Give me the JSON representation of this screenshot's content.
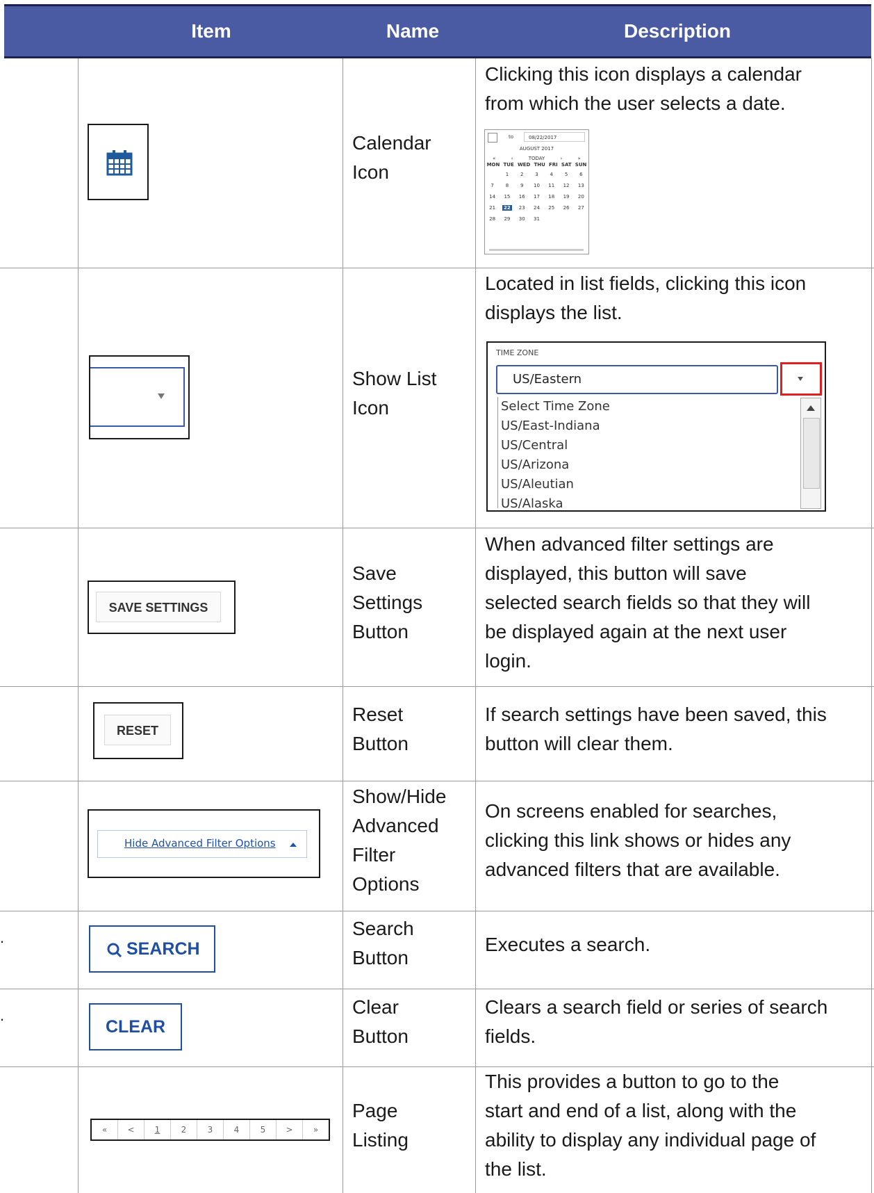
{
  "header": {
    "item": "Item",
    "name": "Name",
    "description": "Description"
  },
  "rows": [
    {
      "name_lines": [
        "Calendar",
        "Icon"
      ],
      "desc_lines": [
        "Clicking this icon displays a calendar",
        "from which the user selects a date."
      ]
    },
    {
      "name_lines": [
        "Show List",
        "Icon"
      ],
      "desc_lines": [
        "Located in list fields, clicking this icon",
        "displays the list."
      ]
    },
    {
      "name_lines": [
        "Save",
        "Settings",
        "Button"
      ],
      "desc_lines": [
        "When advanced filter settings are",
        "displayed, this button will save",
        "selected search fields so that they will",
        "be displayed again at the next user",
        "login."
      ]
    },
    {
      "name_lines": [
        "Reset",
        "Button"
      ],
      "desc_lines": [
        "If search settings have been saved, this",
        "button will clear them."
      ]
    },
    {
      "name_lines": [
        "Show/Hide",
        "Advanced",
        "Filter",
        "Options"
      ],
      "desc_lines": [
        "On screens enabled for searches,",
        "clicking this link shows or hides any",
        "advanced filters that are available."
      ]
    },
    {
      "name_lines": [
        "Search",
        "Button"
      ],
      "desc_lines": [
        "Executes a search."
      ]
    },
    {
      "name_lines": [
        "Clear",
        "Button"
      ],
      "desc_lines": [
        "Clears a search field or series of search",
        "fields."
      ]
    },
    {
      "name_lines": [
        "Page",
        "Listing"
      ],
      "desc_lines": [
        "This provides a button to go to the",
        "start and end of a list, along with the",
        "ability to display any individual page of",
        "the list."
      ]
    }
  ],
  "calendar_popup": {
    "to_label": "to",
    "date_value": "08/22/2017",
    "month": "AUGUST 2017",
    "nav": [
      "«",
      "‹",
      "TODAY",
      "›",
      "»"
    ],
    "weekdays": [
      "MON",
      "TUE",
      "WED",
      "THU",
      "FRI",
      "SAT",
      "SUN"
    ],
    "weeks": [
      [
        "",
        "1",
        "2",
        "3",
        "4",
        "5",
        "6"
      ],
      [
        "7",
        "8",
        "9",
        "10",
        "11",
        "12",
        "13"
      ],
      [
        "14",
        "15",
        "16",
        "17",
        "18",
        "19",
        "20"
      ],
      [
        "21",
        "22",
        "23",
        "24",
        "25",
        "26",
        "27"
      ],
      [
        "28",
        "29",
        "30",
        "31",
        "",
        "",
        ""
      ]
    ],
    "selected_day": "22",
    "accent": "#1f5a9c"
  },
  "timezone": {
    "label": "TIME ZONE",
    "selected": "US/Eastern",
    "options": [
      "Select Time Zone",
      "US/East-Indiana",
      "US/Central",
      "US/Arizona",
      "US/Aleutian",
      "US/Alaska"
    ]
  },
  "buttons": {
    "save_settings": "SAVE SETTINGS",
    "reset": "RESET",
    "hide_filters_link": "Hide Advanced Filter Options",
    "search": "SEARCH",
    "clear": "CLEAR"
  },
  "pager": [
    "«",
    "<",
    "1",
    "2",
    "3",
    "4",
    "5",
    ">",
    "»"
  ],
  "colors": {
    "header_bg": "#4a5aa3",
    "button_blue": "#1f4fa0",
    "highlight_red": "#e02020"
  },
  "icons": [
    "calendar-icon",
    "dropdown-arrow-icon",
    "search-icon",
    "caret-up-icon"
  ]
}
